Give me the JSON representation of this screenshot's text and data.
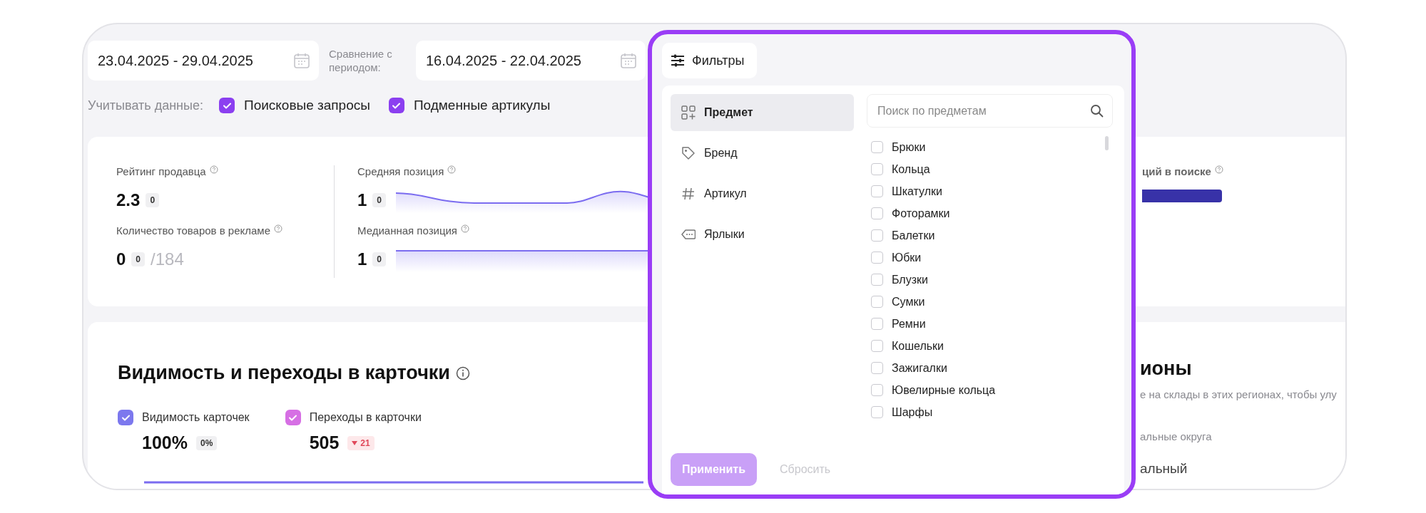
{
  "period": {
    "value": "23.04.2025 - 29.04.2025"
  },
  "comparison": {
    "label": "Сравнение с периодом:",
    "value": "16.04.2025 - 22.04.2025"
  },
  "data_options": {
    "label": "Учитывать данные:",
    "items": [
      {
        "label": "Поисковые запросы",
        "checked": true
      },
      {
        "label": "Подменные артикулы",
        "checked": true
      }
    ]
  },
  "stats": {
    "seller": [
      {
        "label": "Рейтинг продавца",
        "value": "2.3",
        "delta": "0"
      },
      {
        "label": "Количество товаров в рекламе",
        "value": "0",
        "delta": "0",
        "total": "/184"
      }
    ],
    "positions": [
      {
        "label": "Средняя позиция",
        "value": "1",
        "delta": "0",
        "kind": "wave"
      },
      {
        "label": "Медианная позиция",
        "value": "1",
        "delta": "0",
        "kind": "flat"
      }
    ],
    "search_label": "ций в поиске",
    "search_bar": {
      "level": 1
    }
  },
  "visibility": {
    "title": "Видимость и переходы в карточки",
    "metrics": [
      {
        "label": "Видимость карточек",
        "checked": true,
        "color": "#7c78ee",
        "value": "100%",
        "delta": "0%",
        "kind": "neutral"
      },
      {
        "label": "Переходы в карточки",
        "checked": true,
        "color": "#d66fe4",
        "value": "505",
        "delta": "21",
        "kind": "decrease"
      }
    ]
  },
  "regions": {
    "title": "ионы",
    "subtitle": "е на склады в этих регионах, чтобы улу",
    "column_label": "альные округа",
    "row": "альный"
  },
  "filters": {
    "button": "Фильтры",
    "categories": [
      {
        "label": "Предмет",
        "kind": "grid",
        "selected": true
      },
      {
        "label": "Бренд",
        "kind": "tag",
        "selected": false
      },
      {
        "label": "Артикул",
        "kind": "hash",
        "selected": false
      },
      {
        "label": "Ярлыки",
        "kind": "label",
        "selected": false
      }
    ],
    "search": {
      "placeholder": "Поиск по предметам"
    },
    "items": [
      {
        "label": "Брюки",
        "checked": false
      },
      {
        "label": "Кольца",
        "checked": false
      },
      {
        "label": "Шкатулки",
        "checked": false
      },
      {
        "label": "Фоторамки",
        "checked": false
      },
      {
        "label": "Балетки",
        "checked": false
      },
      {
        "label": "Юбки",
        "checked": false
      },
      {
        "label": "Блузки",
        "checked": false
      },
      {
        "label": "Сумки",
        "checked": false
      },
      {
        "label": "Ремни",
        "checked": false
      },
      {
        "label": "Кошельки",
        "checked": false
      },
      {
        "label": "Зажигалки",
        "checked": false
      },
      {
        "label": "Ювелирные кольца",
        "checked": false
      },
      {
        "label": "Шарфы",
        "checked": false
      }
    ],
    "apply": {
      "label": "Применить",
      "disabled": true
    },
    "reset": {
      "label": "Сбросить",
      "disabled": true
    }
  }
}
